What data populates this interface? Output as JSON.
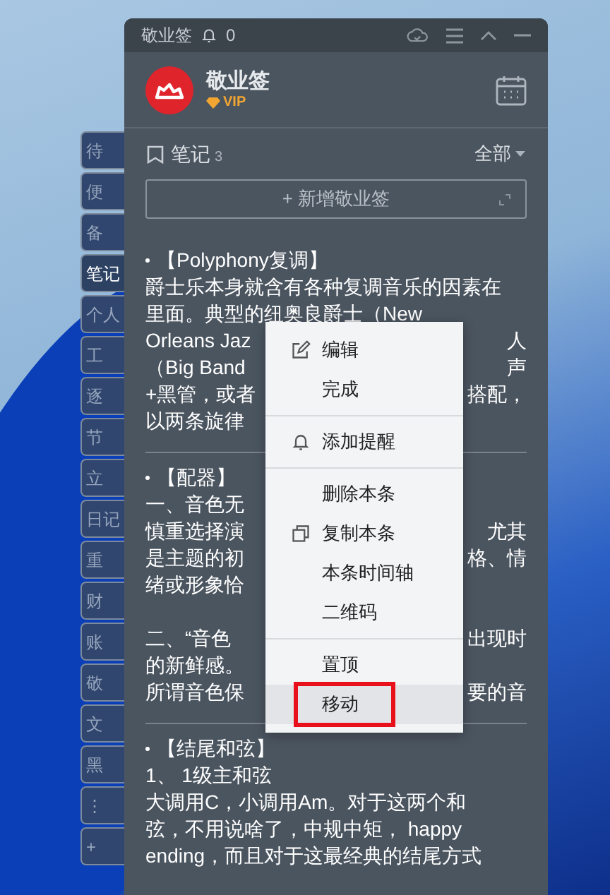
{
  "side_tabs": [
    {
      "label": "待",
      "selected": false
    },
    {
      "label": "便",
      "selected": false
    },
    {
      "label": "备",
      "selected": false
    },
    {
      "label": "笔记",
      "selected": true
    },
    {
      "label": "个人",
      "selected": false
    },
    {
      "label": "工",
      "selected": false
    },
    {
      "label": "逐",
      "selected": false
    },
    {
      "label": "节",
      "selected": false
    },
    {
      "label": "立",
      "selected": false
    },
    {
      "label": "日记",
      "selected": false
    },
    {
      "label": "重",
      "selected": false
    },
    {
      "label": "财",
      "selected": false
    },
    {
      "label": "账",
      "selected": false
    },
    {
      "label": "敬",
      "selected": false
    },
    {
      "label": "文",
      "selected": false
    },
    {
      "label": "黑",
      "selected": false
    },
    {
      "label": "⋮",
      "selected": false
    },
    {
      "label": "+",
      "selected": false
    }
  ],
  "title_bar": {
    "title": "敬业签",
    "reminder_count": "0"
  },
  "profile": {
    "name": "敬业签",
    "badge": "VIP"
  },
  "notes_header": {
    "label": "笔记",
    "count": "3",
    "filter": "全部"
  },
  "new_button": {
    "label": "+ 新增敬业签"
  },
  "notes": [
    {
      "title": "【Polyphony复调】",
      "paragraphs": [
        [
          {
            "left": "爵士乐本身就含有各种复调音乐的因素在"
          },
          {
            "left": "里面。典型的纽奥良爵士（New"
          },
          {
            "left": "Orleans Jaz",
            "right": "人"
          },
          {
            "left": "（Big Band",
            "right": "声"
          },
          {
            "left": "+黑管，或者",
            "right": "搭配，"
          },
          {
            "left": "以两条旋律"
          }
        ]
      ]
    },
    {
      "title": "【配器】",
      "paragraphs": [
        [
          {
            "left": "一、音色无"
          },
          {
            "left": "慎重选择演",
            "right": "尤其"
          },
          {
            "left": "是主题的初",
            "right": "格、情"
          },
          {
            "left": "绪或形象恰"
          }
        ],
        [
          {
            "left": "二、“音色",
            "right": "出现时"
          },
          {
            "left": "的新鲜感。"
          },
          {
            "left": "所谓音色保",
            "right": "要的音"
          }
        ]
      ]
    },
    {
      "title": "【结尾和弦】",
      "paragraphs": [
        [
          {
            "left": "1、 1级主和弦"
          },
          {
            "left": "大调用C，小调用Am。对于这两个和"
          },
          {
            "left": "弦，不用说啥了，中规中矩， happy"
          },
          {
            "left": "ending，而且对于这最经典的结尾方式"
          }
        ]
      ]
    }
  ],
  "context_menu": {
    "groups": [
      [
        {
          "label": "编辑",
          "selected": false,
          "marked": false
        },
        {
          "label": "完成",
          "selected": false,
          "marked": false
        }
      ],
      [
        {
          "label": "添加提醒",
          "selected": false,
          "marked": false
        }
      ],
      [
        {
          "label": "删除本条",
          "selected": false,
          "marked": false
        },
        {
          "label": "复制本条",
          "selected": false,
          "marked": false
        },
        {
          "label": "本条时间轴",
          "selected": false,
          "marked": false
        },
        {
          "label": "二维码",
          "selected": false,
          "marked": false
        }
      ],
      [
        {
          "label": "置顶",
          "selected": false,
          "marked": false
        },
        {
          "label": "移动",
          "selected": true,
          "marked": true
        }
      ]
    ]
  }
}
